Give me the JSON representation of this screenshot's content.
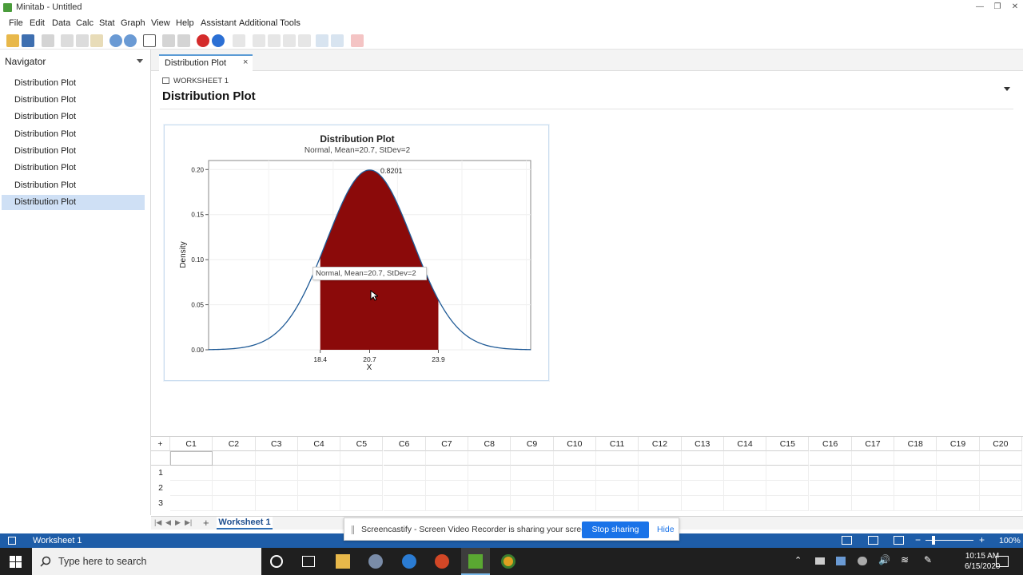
{
  "window": {
    "title": "Minitab - Untitled"
  },
  "menu": [
    "File",
    "Edit",
    "Data",
    "Calc",
    "Stat",
    "Graph",
    "View",
    "Help",
    "Assistant",
    "Additional Tools"
  ],
  "navigator": {
    "title": "Navigator",
    "items": [
      "Distribution Plot",
      "Distribution Plot",
      "Distribution Plot",
      "Distribution Plot",
      "Distribution Plot",
      "Distribution Plot",
      "Distribution Plot",
      "Distribution Plot"
    ],
    "selected_index": 7
  },
  "doc_tab": {
    "label": "Distribution Plot"
  },
  "output": {
    "worksheet_label": "WORKSHEET 1",
    "title": "Distribution Plot"
  },
  "chart_data": {
    "type": "area",
    "title": "Distribution Plot",
    "subtitle": "Normal, Mean=20.7, StDev=2",
    "xlabel": "X",
    "ylabel": "Density",
    "distribution": {
      "name": "Normal",
      "mean": 20.7,
      "stdev": 2
    },
    "xlim": [
      13.2,
      28.2
    ],
    "ylim": [
      0,
      0.21
    ],
    "yticks": [
      "0.00",
      "0.05",
      "0.10",
      "0.15",
      "0.20"
    ],
    "xticks": [
      "18.4",
      "20.7",
      "23.9"
    ],
    "shaded_region": {
      "from": 18.4,
      "to": 23.9,
      "probability": 0.8201
    },
    "probability_label": "0.8201",
    "shade_color": "#8b0a0a",
    "line_color": "#1f5a96",
    "tooltip": "Normal, Mean=20.7, StDev=2"
  },
  "grid": {
    "columns": [
      "C1",
      "C2",
      "C3",
      "C4",
      "C5",
      "C6",
      "C7",
      "C8",
      "C9",
      "C10",
      "C11",
      "C12",
      "C13",
      "C14",
      "C15",
      "C16",
      "C17",
      "C18",
      "C19",
      "C20"
    ],
    "rows": [
      "1",
      "2",
      "3"
    ]
  },
  "sheet_tab": {
    "label": "Worksheet 1"
  },
  "status": {
    "worksheet": "Worksheet 1",
    "zoom": "100%"
  },
  "share_bar": {
    "message": "Screencastify - Screen Video Recorder is sharing your screen.",
    "stop_label": "Stop sharing",
    "hide_label": "Hide"
  },
  "taskbar": {
    "search_placeholder": "Type here to search",
    "time": "10:15 AM",
    "date": "6/15/2020"
  }
}
